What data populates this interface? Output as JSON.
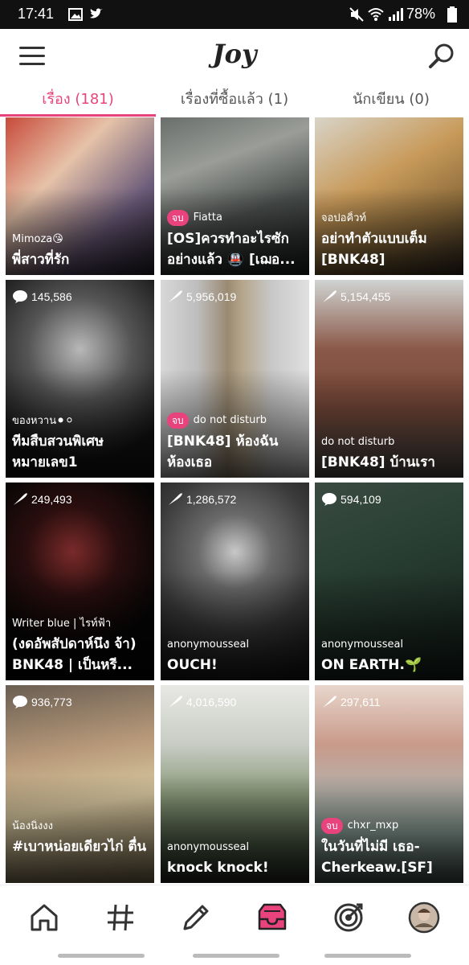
{
  "status_bar": {
    "time": "17:41",
    "battery": "78%"
  },
  "app": {
    "logo_text": "Joy",
    "accent": "#e8437d"
  },
  "tabs": [
    {
      "label": "เรื่อง (181)",
      "active": true
    },
    {
      "label": "เรื่องที่ซื้อแล้ว (1)",
      "active": false
    },
    {
      "label": "นักเขียน (0)",
      "active": false
    }
  ],
  "cards": [
    {
      "views": "",
      "badge": "",
      "author": "Mimoza😘",
      "title": "พี่สาวที่รัก"
    },
    {
      "views": "",
      "badge": "จบ",
      "author": "Fiatta",
      "title": "[OS]ควรทำอะไรซักอย่างแล้ว 🚇 [เฌอ..."
    },
    {
      "views": "",
      "badge": "",
      "author": "จอปอคิ้วท์",
      "title": "อย่าทำตัวแบบเต็ม [BNK48]"
    },
    {
      "views": "145,586",
      "badge": "",
      "author": "ของหวาน⚫⚪",
      "title": "ทีมสืบสวนพิเศษ หมายเลข1"
    },
    {
      "views": "5,956,019",
      "badge": "จบ",
      "author": "do not disturb",
      "title": "[BNK48] ห้องฉัน ห้องเธอ"
    },
    {
      "views": "5,154,455",
      "badge": "",
      "author": "do not disturb",
      "title": "[BNK48] บ้านเรา"
    },
    {
      "views": "249,493",
      "badge": "",
      "author": "Writer blue | ไรท์ฟ้า",
      "title": "(งดอัพสัปดาห์นึง จ้า) BNK48 | เป็นหรี..."
    },
    {
      "views": "1,286,572",
      "badge": "",
      "author": "anonymousseal",
      "title": "OUCH!"
    },
    {
      "views": "594,109",
      "badge": "",
      "author": "anonymousseal",
      "title": "ON EARTH.🌱"
    },
    {
      "views": "936,773",
      "badge": "",
      "author": "น้องนิ่งงง",
      "title": "#เบาหน่อยเดียวไก่ ตื่น"
    },
    {
      "views": "4,016,590",
      "badge": "",
      "author": "anonymousseal",
      "title": "knock knock!"
    },
    {
      "views": "297,611",
      "badge": "จบ",
      "author": "chxr_mxp",
      "title": "ในวันที่ไม่มี เธอ-Cherkeaw.[SF]"
    }
  ],
  "bottom_nav": [
    {
      "icon": "home-icon"
    },
    {
      "icon": "hashtag-icon"
    },
    {
      "icon": "pencil-icon"
    },
    {
      "icon": "inbox-icon",
      "active": true
    },
    {
      "icon": "target-icon"
    },
    {
      "icon": "profile-avatar-icon"
    }
  ]
}
